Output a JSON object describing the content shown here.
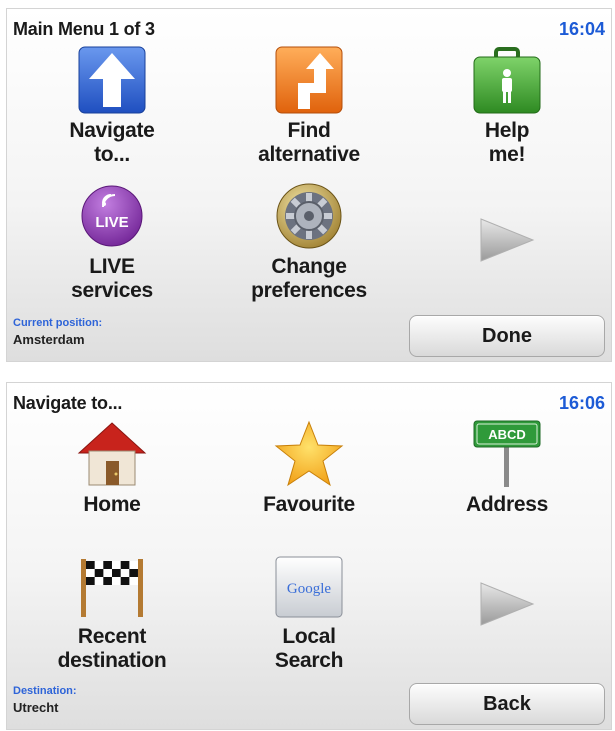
{
  "screen1": {
    "title": "Main Menu 1 of 3",
    "time": "16:04",
    "items": [
      {
        "label": "Navigate\nto...",
        "icon": "navigate-up-arrow-icon"
      },
      {
        "label": "Find\nalternative",
        "icon": "alternative-route-icon"
      },
      {
        "label": "Help\nme!",
        "icon": "first-aid-kit-icon"
      },
      {
        "label": "LIVE\nservices",
        "icon": "live-services-icon",
        "badge": "LIVE"
      },
      {
        "label": "Change\npreferences",
        "icon": "preferences-gear-icon"
      }
    ],
    "next_icon": "next-page-arrow-icon",
    "status": {
      "caption": "Current position:",
      "value": "Amsterdam"
    },
    "button": "Done"
  },
  "screen2": {
    "title": "Navigate to...",
    "time": "16:06",
    "items": [
      {
        "label": "Home",
        "icon": "home-icon"
      },
      {
        "label": "Favourite",
        "icon": "star-icon"
      },
      {
        "label": "Address",
        "icon": "street-sign-icon",
        "sign_text": "ABCD"
      },
      {
        "label": "Recent\ndestination",
        "icon": "checkered-flag-icon"
      },
      {
        "label": "Local\nSearch",
        "icon": "google-search-icon",
        "logo_text": "Google"
      }
    ],
    "next_icon": "next-page-arrow-icon",
    "status": {
      "caption": "Destination:",
      "value": "Utrecht"
    },
    "button": "Back"
  },
  "colors": {
    "time_blue": "#1d5bd6",
    "caption_blue": "#2e64d8",
    "navigate_blue": "#2a5fd0",
    "alternative_orange": "#f07a1a",
    "help_green": "#3f9d2e",
    "live_purple": "#8a3aa8",
    "sign_green": "#2f9a3a"
  }
}
